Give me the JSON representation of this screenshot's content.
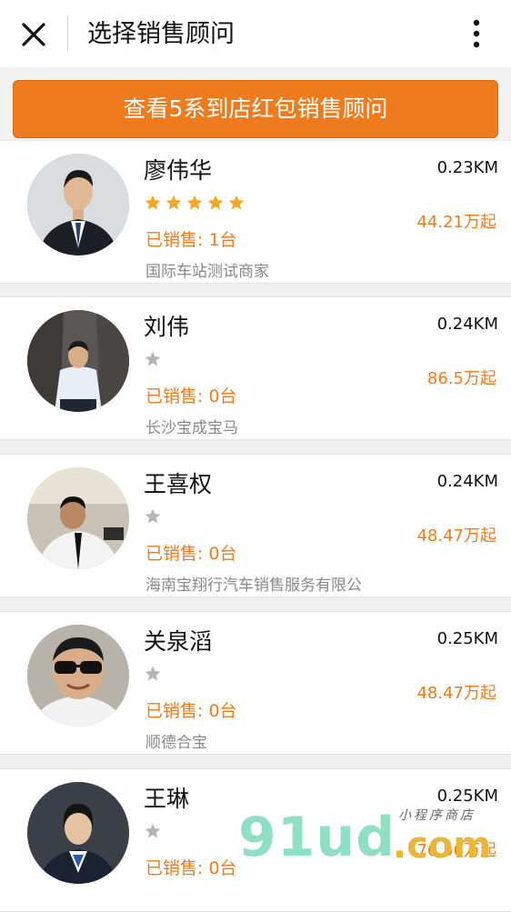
{
  "header": {
    "title": "选择销售顾问",
    "close_icon": "close-icon",
    "more_icon": "more-vertical-icon"
  },
  "banner": {
    "label": "查看5系到店红包销售顾问"
  },
  "colors": {
    "accent": "#ee7b1e",
    "star_active": "#f5a623",
    "star_inactive": "#b5b5b5"
  },
  "advisors": [
    {
      "name": "廖伟华",
      "stars": 5,
      "sold": "已销售: 1台",
      "dealer": "国际车站测试商家",
      "distance": "0.23KM",
      "price": "44.21万起"
    },
    {
      "name": "刘伟",
      "stars": 1,
      "sold": "已销售: 0台",
      "dealer": "长沙宝成宝马",
      "distance": "0.24KM",
      "price": "86.5万起"
    },
    {
      "name": "王喜权",
      "stars": 1,
      "sold": "已销售: 0台",
      "dealer": "海南宝翔行汽车销售服务有限公",
      "distance": "0.24KM",
      "price": "48.47万起"
    },
    {
      "name": "关泉滔",
      "stars": 1,
      "sold": "已销售: 0台",
      "dealer": "顺德合宝",
      "distance": "0.25KM",
      "price": "48.47万起"
    },
    {
      "name": "王琳",
      "stars": 1,
      "sold": "已销售: 0台",
      "dealer": "",
      "distance": "0.25KM",
      "price": "76.56万起"
    }
  ],
  "watermark": {
    "big": "91ud",
    "domain": ".com",
    "small": "小程序商店"
  }
}
